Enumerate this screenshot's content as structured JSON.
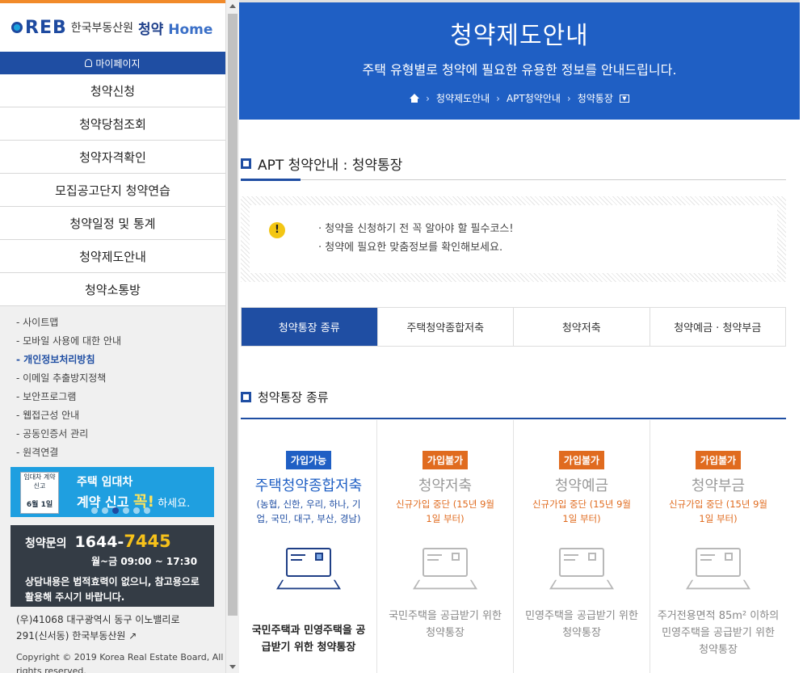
{
  "logo": {
    "brand": "REB",
    "org": "한국부동산원",
    "service": "청약",
    "home": "Home"
  },
  "mypage": {
    "label": "마이페이지"
  },
  "menu": [
    {
      "label": "청약신청"
    },
    {
      "label": "청약당첨조회"
    },
    {
      "label": "청약자격확인"
    },
    {
      "label": "모집공고단지 청약연습"
    },
    {
      "label": "청약일정 및 통계"
    },
    {
      "label": "청약제도안내"
    },
    {
      "label": "청약소통방"
    }
  ],
  "footer_links": [
    {
      "label": "- 사이트맵",
      "active": false
    },
    {
      "label": "- 모바일 사용에 대한 안내",
      "active": false
    },
    {
      "label": "- 개인정보처리방침",
      "active": true
    },
    {
      "label": "- 이메일 추출방지정책",
      "active": false
    },
    {
      "label": "- 보안프로그램",
      "active": false
    },
    {
      "label": "- 웹접근성 안내",
      "active": false
    },
    {
      "label": "- 공동인증서 관리",
      "active": false
    },
    {
      "label": "- 원격연결",
      "active": false
    }
  ],
  "banner": {
    "doc_title": "임대차 계약 신고",
    "doc_date": "6월 1일",
    "line1": "주택 임대차",
    "line2_a": "계약 신고",
    "line2_b": "꼭!",
    "line2_c": "하세요."
  },
  "contact": {
    "label": "청약문의",
    "phone_a": "1644-",
    "phone_b": "7445",
    "hours": "월~금 09:00 ~ 17:30",
    "note_1": "상담내용은 법적효력이 없으니, 참고용으로",
    "note_2": "활용해 주시기 바랍니다."
  },
  "address": {
    "line1": "(우)41068 대구광역시 동구 이노밸리로",
    "line2": "291(신서동) 한국부동산원"
  },
  "copyright": {
    "line1": "Copyright © 2019 Korea Real Estate Board, All",
    "line2": "rights reserved."
  },
  "hero": {
    "title": "청약제도안내",
    "subtitle": "주택 유형별로 청약에 필요한 유용한 정보를 안내드립니다.",
    "breadcrumb": [
      "청약제도안내",
      "APT청약안내",
      "청약통장"
    ]
  },
  "section_apt": {
    "title": "APT 청약안내 : 청약통장"
  },
  "notice": {
    "lines": [
      "· 청약을 신청하기 전 꼭 알아야 할 필수코스!",
      "· 청약에 필요한 맞춤정보를 확인해보세요."
    ]
  },
  "tabs": [
    {
      "label": "청약통장 종류",
      "active": true
    },
    {
      "label": "주택청약종합저축",
      "active": false
    },
    {
      "label": "청약저축",
      "active": false
    },
    {
      "label": "청약예금 · 청약부금",
      "active": false
    }
  ],
  "section_types": {
    "title": "청약통장 종류"
  },
  "cards": [
    {
      "badge": "가입가능",
      "status": "ok",
      "name": "주택청약종합저축",
      "desc": "(농협, 신한, 우리, 하나, 기업, 국민, 대구, 부산, 경남)",
      "foot": "국민주택과 민영주택을 공급받기 위한 청약통장"
    },
    {
      "badge": "가입불가",
      "status": "no",
      "name": "청약저축",
      "desc": "신규가입 중단 (15년 9월 1일 부터)",
      "foot": "국민주택을 공급받기 위한 청약통장"
    },
    {
      "badge": "가입불가",
      "status": "no",
      "name": "청약예금",
      "desc": "신규가입 중단 (15년 9월 1일 부터)",
      "foot": "민영주택을 공급받기 위한 청약통장"
    },
    {
      "badge": "가입불가",
      "status": "no",
      "name": "청약부금",
      "desc": "신규가입 중단 (15년 9월 1일 부터)",
      "foot": "주거전용면적 85m² 이하의 민영주택을 공급받기 위한 청약통장"
    }
  ],
  "colors": {
    "primary": "#1f4ea3",
    "hero_blue": "#1f5fc4",
    "orange": "#e06b1f",
    "accent_top": "#f18a2a"
  }
}
